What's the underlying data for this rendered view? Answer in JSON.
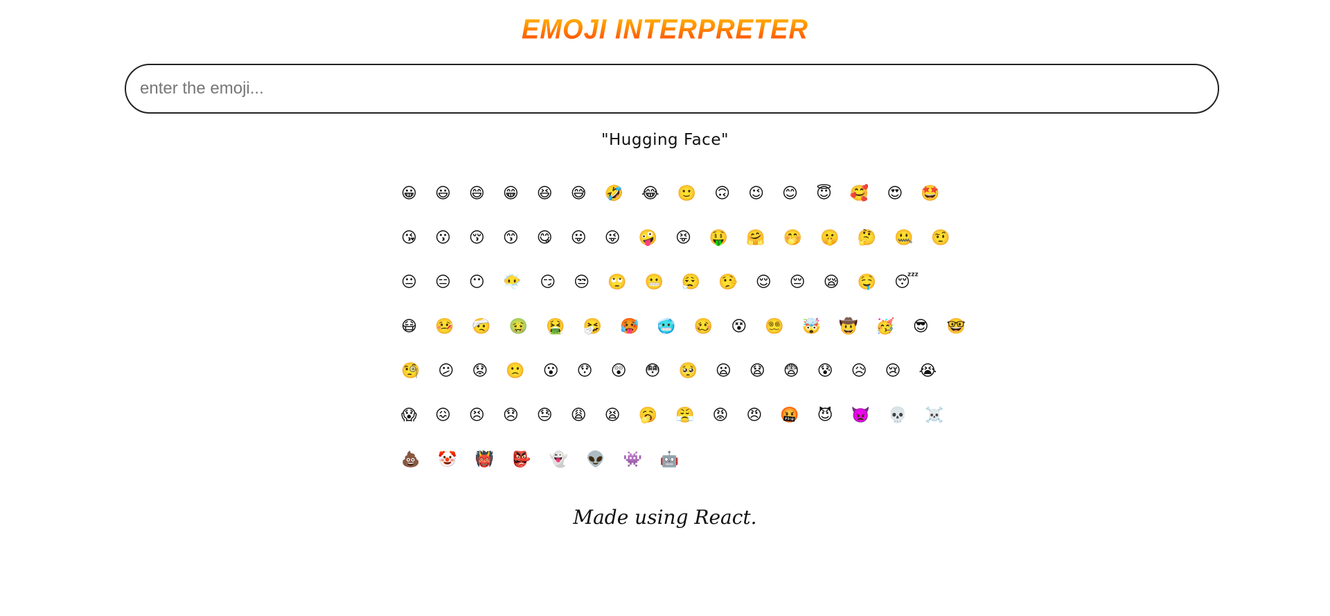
{
  "header": {
    "title": "EMOJI INTERPRETER"
  },
  "search": {
    "placeholder": "enter the emoji...",
    "value": ""
  },
  "output": {
    "meaning_display": "\"Hugging Face\""
  },
  "emoji_rows": [
    [
      "😀",
      "😃",
      "😄",
      "😁",
      "😆",
      "😅",
      "🤣",
      "😂",
      "🙂",
      "🙃",
      "😉",
      "😊",
      "😇",
      "🥰",
      "😍",
      "🤩"
    ],
    [
      "😘",
      "😗",
      "😚",
      "😙",
      "😋",
      "😛",
      "😜",
      "🤪",
      "😝",
      "🤑",
      "🤗",
      "🤭",
      "🤫",
      "🤔",
      "🤐",
      "🤨"
    ],
    [
      "😐",
      "😑",
      "😶",
      "😶‍🌫️",
      "😏",
      "😒",
      "🙄",
      "😬",
      "😮‍💨",
      "🤥",
      "😌",
      "😔",
      "😪",
      "🤤",
      "😴"
    ],
    [
      "😷",
      "🤒",
      "🤕",
      "🤢",
      "🤮",
      "🤧",
      "🥵",
      "🥶",
      "🥴",
      "😵",
      "😵‍💫",
      "🤯",
      "🤠",
      "🥳",
      "😎",
      "🤓"
    ],
    [
      "🧐",
      "😕",
      "😟",
      "🙁",
      "😮",
      "😯",
      "😲",
      "😳",
      "🥺",
      "😦",
      "😧",
      "😨",
      "😰",
      "😥",
      "😢",
      "😭"
    ],
    [
      "😱",
      "😖",
      "😣",
      "😞",
      "😓",
      "😩",
      "😫",
      "🥱",
      "😤",
      "😡",
      "😠",
      "🤬",
      "😈",
      "👿",
      "💀",
      "☠️"
    ],
    [
      "💩",
      "🤡",
      "👹",
      "👺",
      "👻",
      "👽",
      "👾",
      "🤖"
    ]
  ],
  "footer": {
    "text": "Made using React."
  }
}
